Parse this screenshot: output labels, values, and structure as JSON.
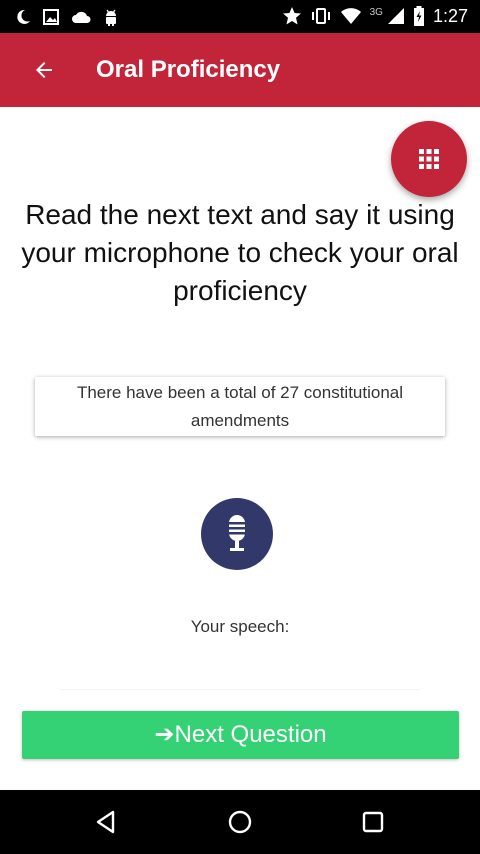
{
  "status_bar": {
    "network_type": "3G",
    "time": "1:27",
    "icons": [
      "moon-icon",
      "image-icon",
      "cloud-icon",
      "android-icon",
      "star-icon",
      "vibrate-icon",
      "wifi-icon",
      "signal-icon",
      "battery-charging-icon"
    ]
  },
  "app_bar": {
    "title": "Oral Proficiency",
    "back_icon": "arrow-left-icon",
    "color": "#c2243a"
  },
  "fab": {
    "icon": "grid-menu-icon",
    "color": "#c2243a"
  },
  "instruction": "Read the next text and say it using your microphone to check your oral proficiency",
  "text_card": {
    "text": "There have been a total of 27 constitutional amendments"
  },
  "mic_button": {
    "icon": "microphone-icon",
    "color": "#33386b"
  },
  "speech_label": "Your speech:",
  "next_button": {
    "label": "➔Next Question",
    "color": "#34d175"
  },
  "nav_bar": {
    "buttons": [
      "back-triangle-icon",
      "home-circle-icon",
      "recents-square-icon"
    ]
  }
}
